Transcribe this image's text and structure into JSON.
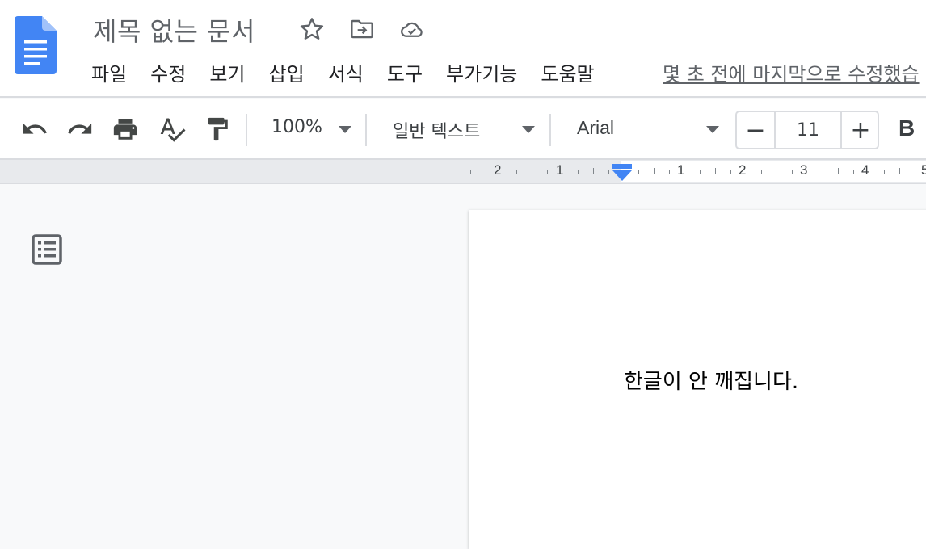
{
  "app": {
    "doc_title": "제목 없는 문서",
    "title_icons": [
      "star-icon",
      "move-to-folder-icon",
      "cloud-saved-icon"
    ],
    "brand_color": "#4285f4"
  },
  "menu": {
    "items": [
      "파일",
      "수정",
      "보기",
      "삽입",
      "서식",
      "도구",
      "부가기능",
      "도움말"
    ],
    "last_edit": "몇 초 전에 마지막으로 수정했습"
  },
  "toolbar": {
    "icons": [
      "undo-icon",
      "redo-icon",
      "print-icon",
      "spellcheck-icon",
      "paint-format-icon"
    ],
    "zoom": "100%",
    "style": "일반 텍스트",
    "font": "Arial",
    "font_size": "11",
    "minus": "−",
    "plus": "+",
    "bold": "B"
  },
  "ruler": {
    "left_numbers": [
      "2",
      "1"
    ],
    "right_numbers": [
      "1",
      "2",
      "3",
      "4",
      "5"
    ]
  },
  "document": {
    "body_text": "한글이 안 깨집니다."
  }
}
